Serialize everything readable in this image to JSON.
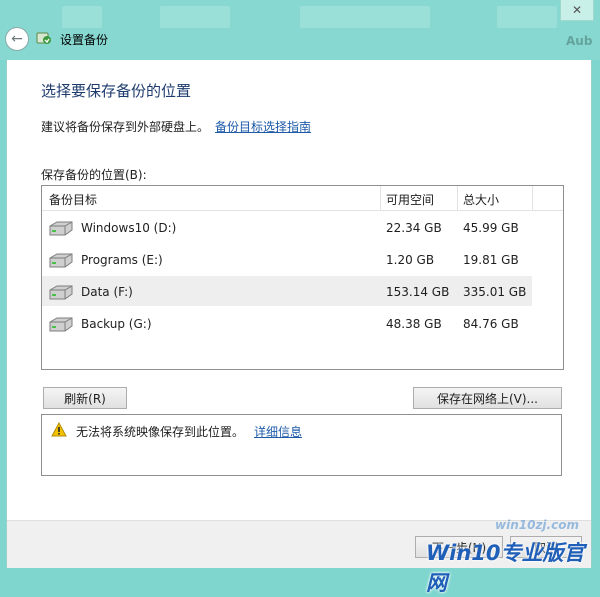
{
  "window": {
    "title": "设置备份",
    "close_glyph": "✕",
    "back_glyph": "←",
    "bg_ghost_text": "Aub"
  },
  "page": {
    "heading": "选择要保存备份的位置",
    "advice_text": "建议将备份保存到外部硬盘上。",
    "advice_link": "备份目标选择指南",
    "list_caption": "保存备份的位置(B):"
  },
  "table": {
    "columns": [
      "备份目标",
      "可用空间",
      "总大小"
    ],
    "rows": [
      {
        "name": "Windows10 (D:)",
        "free": "22.34 GB",
        "total": "45.99 GB",
        "selected": false
      },
      {
        "name": "Programs (E:)",
        "free": "1.20 GB",
        "total": "19.81 GB",
        "selected": false
      },
      {
        "name": "Data (F:)",
        "free": "153.14 GB",
        "total": "335.01 GB",
        "selected": true
      },
      {
        "name": "Backup (G:)",
        "free": "48.38 GB",
        "total": "84.76 GB",
        "selected": false
      }
    ]
  },
  "buttons": {
    "refresh": "刷新(R)",
    "save_network": "保存在网络上(V)...",
    "next": "下一步(N)",
    "cancel": "取消"
  },
  "info": {
    "warning": "无法将系统映像保存到此位置。",
    "details_link": "详细信息"
  },
  "watermark": {
    "small": "win10zj.com",
    "main": "Win10专业版官网"
  },
  "colors": {
    "titlebar": "#86d8d1",
    "heading": "#1e3b6e",
    "link": "#1e5aa8",
    "selected_row": "#eeeeee",
    "warning": "#f2c200",
    "watermark": "#1f5fb8"
  },
  "icons": {
    "back": "back-arrow-icon",
    "app": "backup-app-icon",
    "drive": "hard-drive-icon",
    "warning": "warning-icon",
    "close": "close-icon"
  }
}
